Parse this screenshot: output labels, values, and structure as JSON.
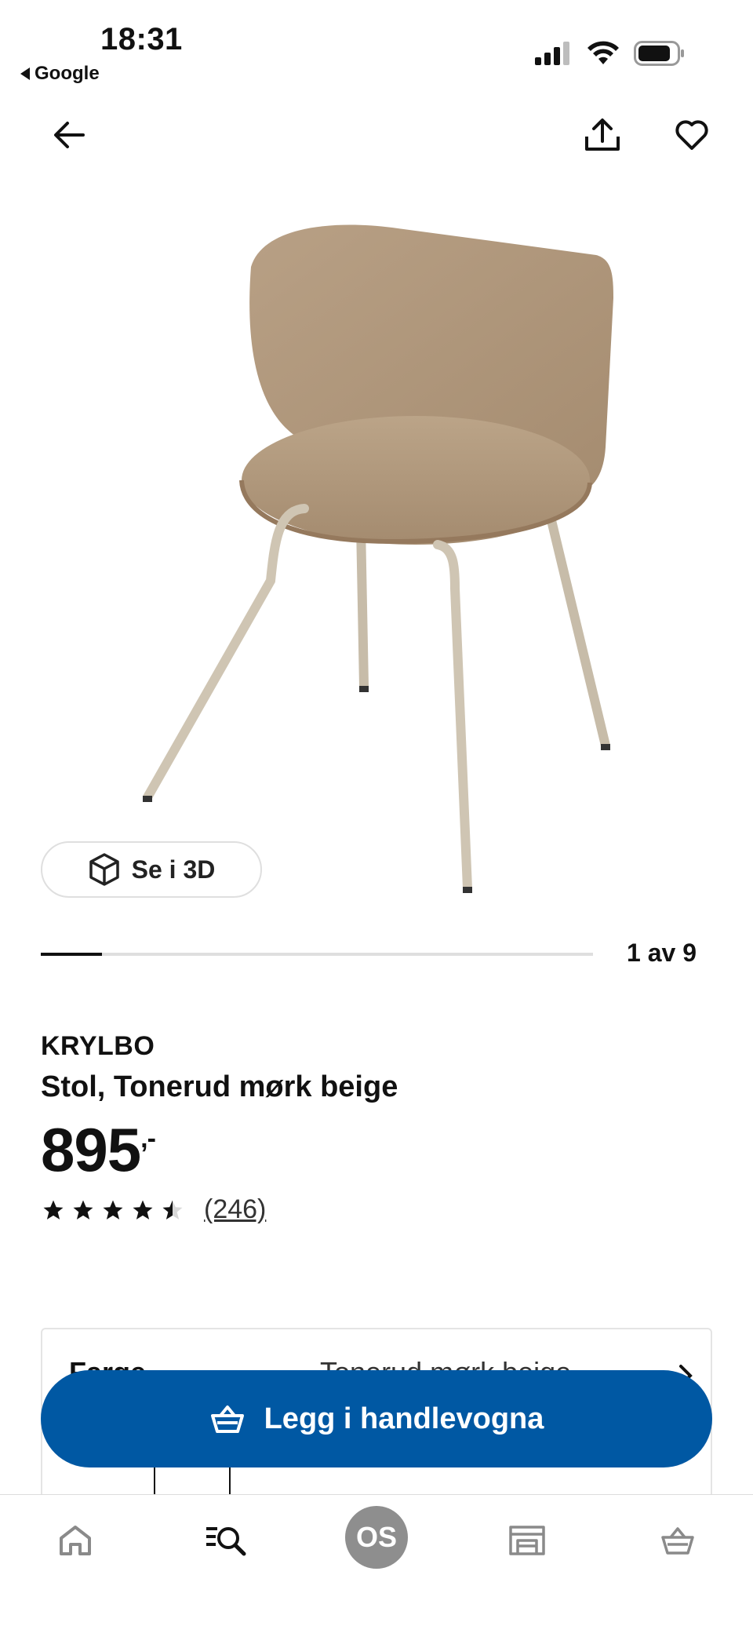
{
  "status_bar": {
    "time": "18:31",
    "back_app": "Google"
  },
  "top_nav": {
    "back_icon": "arrow-left-icon",
    "share_icon": "share-icon",
    "favorite_icon": "heart-icon"
  },
  "gallery": {
    "view_3d_label": "Se i 3D",
    "counter": "1 av 9",
    "current": 1,
    "total": 9
  },
  "product": {
    "brand": "KRYLBO",
    "description": "Stol, Tonerud mørk beige",
    "price": "895",
    "price_suffix": ",-",
    "rating": 4.5,
    "review_count": "(246)"
  },
  "options": {
    "label": "Farge",
    "value": "Tonerud mørk beige"
  },
  "cart_button": {
    "label": "Legg i handlevogna"
  },
  "tab_bar": {
    "profile_initials": "OS"
  },
  "colors": {
    "primary_blue": "#0058a3",
    "chair_fabric": "#b39a80",
    "chair_legs": "#c9bfae"
  }
}
